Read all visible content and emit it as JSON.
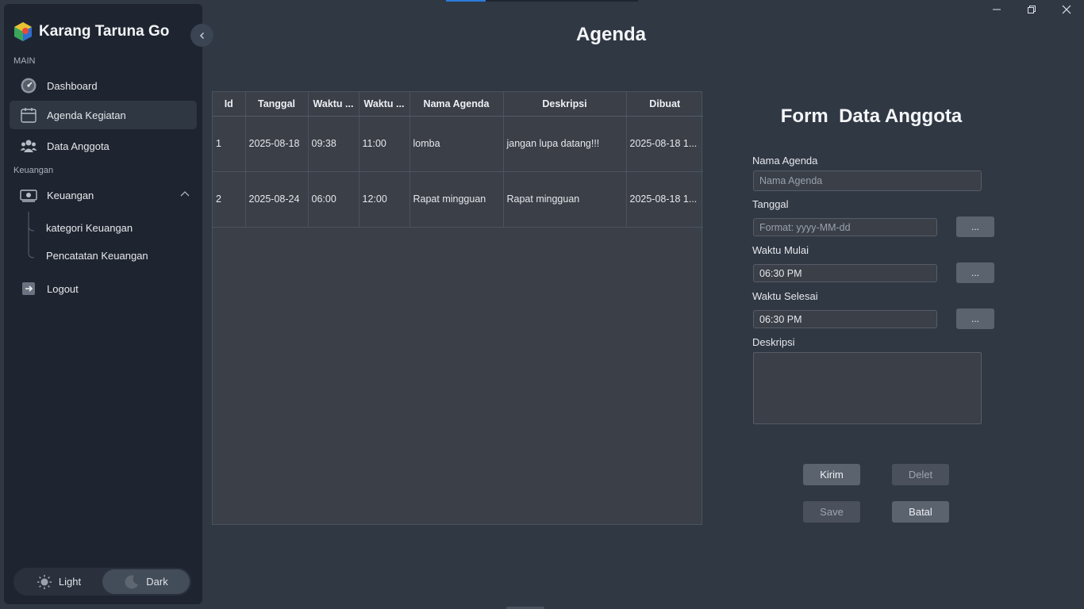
{
  "app": {
    "title": "Karang Taruna Go"
  },
  "sidebar": {
    "section_main": "MAIN",
    "section_finance": "Keuangan",
    "items": [
      {
        "label": "Dashboard",
        "icon": "gauge-icon"
      },
      {
        "label": "Agenda Kegiatan",
        "icon": "calendar-icon"
      },
      {
        "label": "Data Anggota",
        "icon": "users-icon"
      },
      {
        "label": "Keuangan",
        "icon": "money-icon"
      },
      {
        "label": "Logout",
        "icon": "logout-icon"
      }
    ],
    "sub_items": [
      {
        "label": "kategori Keuangan"
      },
      {
        "label": "Pencatatan Keuangan"
      }
    ],
    "theme": {
      "light": "Light",
      "dark": "Dark",
      "selected": "Dark"
    }
  },
  "page": {
    "title": "Agenda"
  },
  "table": {
    "columns": [
      "Id",
      "Tanggal",
      "Waktu ...",
      "Waktu ...",
      "Nama Agenda",
      "Deskripsi",
      "Dibuat"
    ],
    "rows": [
      [
        "1",
        "2025-08-18",
        "09:38",
        "11:00",
        "lomba",
        "jangan lupa datang!!!",
        "2025-08-18 1..."
      ],
      [
        "2",
        "2025-08-24",
        "06:00",
        "12:00",
        "Rapat mingguan",
        "Rapat mingguan",
        "2025-08-18 1..."
      ]
    ]
  },
  "form": {
    "title": "Form  Data Anggota",
    "nama_agenda": {
      "label": "Nama Agenda",
      "placeholder": "Nama Agenda",
      "value": ""
    },
    "tanggal": {
      "label": "Tanggal",
      "placeholder": "Format: yyyy-MM-dd",
      "value": ""
    },
    "waktu_mulai": {
      "label": "Waktu Mulai",
      "value": "06:30 PM"
    },
    "waktu_selesai": {
      "label": "Waktu Selesai",
      "value": "06:30 PM"
    },
    "deskripsi": {
      "label": "Deskripsi",
      "value": ""
    },
    "picker_label": "...",
    "buttons": {
      "kirim": "Kirim",
      "delet": "Delet",
      "save": "Save",
      "batal": "Batal"
    }
  }
}
